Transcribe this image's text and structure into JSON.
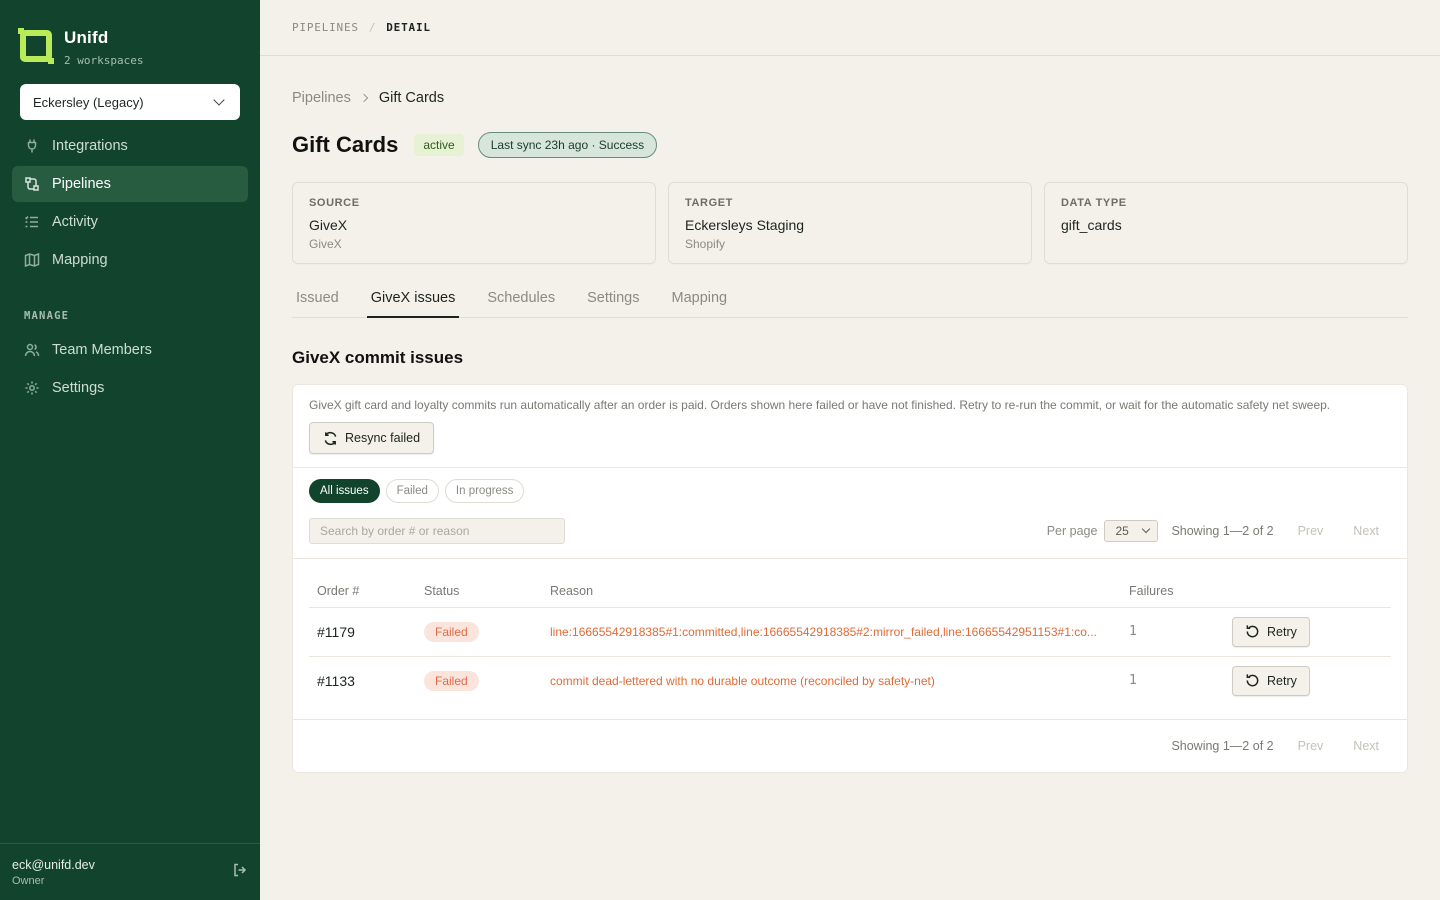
{
  "app": {
    "name": "Unifd",
    "workspaces_label": "2 workspaces",
    "workspace_selected": "Eckersley (Legacy)"
  },
  "sidebar": {
    "items": [
      {
        "label": "Integrations",
        "icon": "plug-icon"
      },
      {
        "label": "Pipelines",
        "icon": "pipeline-icon",
        "active": true
      },
      {
        "label": "Activity",
        "icon": "list-check-icon"
      },
      {
        "label": "Mapping",
        "icon": "map-icon"
      }
    ],
    "manage_heading": "MANAGE",
    "manage_items": [
      {
        "label": "Team Members",
        "icon": "users-icon"
      },
      {
        "label": "Settings",
        "icon": "gear-icon"
      }
    ],
    "user": {
      "email": "eck@unifd.dev",
      "role": "Owner"
    }
  },
  "topbar": {
    "crumb1": "PIPELINES",
    "separator": "/",
    "crumb2": "DETAIL"
  },
  "breadcrumb": {
    "parent": "Pipelines",
    "current": "Gift Cards"
  },
  "header": {
    "title": "Gift Cards",
    "status_badge": "active",
    "sync_badge": "Last sync 23h ago · Success"
  },
  "cards": [
    {
      "label": "SOURCE",
      "value": "GiveX",
      "sub": "GiveX"
    },
    {
      "label": "TARGET",
      "value": "Eckersleys Staging",
      "sub": "Shopify"
    },
    {
      "label": "DATA TYPE",
      "value": "gift_cards",
      "sub": ""
    }
  ],
  "tabs": [
    {
      "label": "Issued"
    },
    {
      "label": "GiveX issues",
      "active": true
    },
    {
      "label": "Schedules"
    },
    {
      "label": "Settings"
    },
    {
      "label": "Mapping"
    }
  ],
  "section": {
    "title": "GiveX commit issues",
    "intro": "GiveX gift card and loyalty commits run automatically after an order is paid. Orders shown here failed or have not finished. Retry to re-run the commit, or wait for the automatic safety net sweep.",
    "resync_label": "Resync failed"
  },
  "filters": [
    {
      "label": "All issues",
      "active": true
    },
    {
      "label": "Failed"
    },
    {
      "label": "In progress"
    }
  ],
  "search": {
    "placeholder": "Search by order # or reason"
  },
  "pager": {
    "per_page_label": "Per page",
    "per_page_value": "25",
    "showing": "Showing 1—2 of 2",
    "prev": "Prev",
    "next": "Next"
  },
  "table": {
    "columns": [
      "Order #",
      "Status",
      "Reason",
      "Failures",
      ""
    ],
    "rows": [
      {
        "order": "#1179",
        "status": "Failed",
        "reason": "line:16665542918385#1:committed,line:16665542918385#2:mirror_failed,line:16665542951153#1:co...",
        "failures": "1",
        "action": "Retry"
      },
      {
        "order": "#1133",
        "status": "Failed",
        "reason": "commit dead-lettered with no durable outcome (reconciled by safety-net)",
        "failures": "1",
        "action": "Retry"
      }
    ]
  },
  "colors": {
    "sidebar_bg": "#12442d",
    "accent": "#b8ea5a",
    "failed": "#e06a4a"
  }
}
